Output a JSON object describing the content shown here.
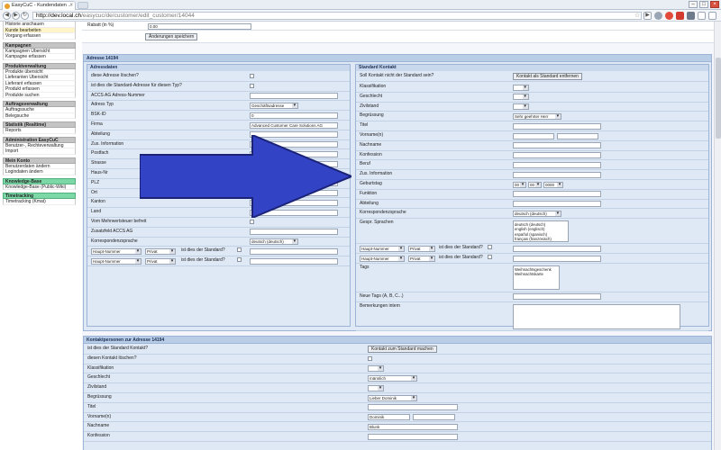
{
  "browser": {
    "tab_title": "EasyCuC - Kundendaten ...",
    "url_host": "http://dev.local.ch",
    "url_path": "/easycuc/de/customer/edit_customer/14044"
  },
  "sidebar": [
    {
      "items": [
        "Historie anschauen",
        "Kunde bearbeiten",
        "Vorgang erfassen"
      ],
      "active": 1
    },
    {
      "title": "Kampagnen",
      "items": [
        "Kampagnen Übersicht",
        "Kampagne erfassen"
      ]
    },
    {
      "title": "Produktverwaltung",
      "items": [
        "Produkte übersicht",
        "Lieferanten Übersicht",
        "Lieferant erfassen",
        "Produkt erfassen",
        "Produkte suchen"
      ]
    },
    {
      "title": "Auftragsverwaltung",
      "items": [
        "Auftragssuche",
        "Belegsuche"
      ]
    },
    {
      "title": "Statistik (Realtime)",
      "items": [
        "Reports"
      ]
    },
    {
      "title": "Administration EasyCuC",
      "items": [
        "Benutzer-, Rechteverwaltung",
        "Import"
      ]
    },
    {
      "title": "Mein Konto",
      "items": [
        "Benutzerdaten ändern",
        "Logindaten ändern"
      ]
    },
    {
      "title": "Knowledge-Base",
      "items": [
        "Knowledge-Base (Public-Wiki)"
      ],
      "green": true
    },
    {
      "title": "Timetracking",
      "items": [
        "Timetracking (Kmat)"
      ],
      "green": true
    }
  ],
  "top": {
    "rabatt_label": "Rabatt (in %)",
    "rabatt_value": "0.00",
    "save_button": "Änderungen speichern"
  },
  "address": {
    "section_title": "Adresse 14194",
    "left_title": "Adressdaten",
    "rows": [
      {
        "label": "diese Adresse löschen?",
        "type": "checkbox"
      },
      {
        "label": "ist dies die Standard-Adresse für diesen Typ?",
        "type": "checkbox"
      },
      {
        "label": "ACCS AG Adress-Nummer",
        "type": "input",
        "value": ""
      },
      {
        "label": "Adress Typ",
        "type": "select",
        "value": "Geschäftsadresse"
      },
      {
        "label": "BSK-ID",
        "type": "input",
        "value": "0"
      },
      {
        "label": "Firma",
        "type": "input",
        "value": "Advanced Customer Care Solutions AG"
      },
      {
        "label": "Abteilung",
        "type": "input",
        "value": ""
      },
      {
        "label": "Zus. Information",
        "type": "input",
        "value": ""
      },
      {
        "label": "Postfach",
        "type": "input",
        "value": ""
      },
      {
        "label": "Strasse",
        "type": "input",
        "value": ""
      },
      {
        "label": "Haus-Nr",
        "type": "input",
        "value": ""
      },
      {
        "label": "PLZ",
        "type": "input",
        "value": ""
      },
      {
        "label": "Ort",
        "type": "input",
        "value": ""
      },
      {
        "label": "Kanton",
        "type": "input",
        "value": ""
      },
      {
        "label": "Land",
        "type": "input",
        "value": ""
      },
      {
        "label": "Vom Mehrwertsteuer befreit",
        "type": "checkbox"
      },
      {
        "label": "Zusatzfeld ACCS AG",
        "type": "input",
        "value": ""
      },
      {
        "label": "Korrespondenzsprache",
        "type": "select",
        "value": "deutsch (deutsch)"
      }
    ],
    "phone_type": "Haupt-Nummer",
    "phone_kind": "Privat",
    "phone_question": "ist dies der Standard?",
    "right_title": "Standard Kontakt",
    "contact_rows": [
      {
        "label": "Soll Kontakt nicht der Standard sein?",
        "type": "button",
        "value": "Kontakt als Standard entfernen"
      },
      {
        "label": "Klassifikation",
        "type": "select",
        "value": ""
      },
      {
        "label": "Geschlecht",
        "type": "select",
        "value": ""
      },
      {
        "label": "Zivilstand",
        "type": "select",
        "value": ""
      },
      {
        "label": "Begrüssung",
        "type": "select",
        "value": "Sehr geehrter Herr"
      },
      {
        "label": "Titel",
        "type": "input",
        "value": ""
      },
      {
        "label": "Vorname(n)",
        "type": "input2",
        "value": ""
      },
      {
        "label": "Nachname",
        "type": "input",
        "value": ""
      },
      {
        "label": "Konfession",
        "type": "input",
        "value": ""
      },
      {
        "label": "Beruf",
        "type": "input",
        "value": ""
      },
      {
        "label": "Zus. Information",
        "type": "input",
        "value": ""
      },
      {
        "label": "Geburtstag",
        "type": "date",
        "value": "00",
        "value2": "00",
        "value3": "0000"
      },
      {
        "label": "Funktion",
        "type": "input",
        "value": ""
      },
      {
        "label": "Abteilung",
        "type": "input",
        "value": ""
      },
      {
        "label": "Korrespondenzsprache",
        "type": "select",
        "value": "deutsch (deutsch)"
      }
    ],
    "languages_label": "Gespr. Sprachen",
    "languages": [
      "deutsch (deutsch)",
      "english (englisch)",
      "español (spanisch)",
      "français (französisch)"
    ],
    "tags_label": "Tags",
    "tags": [
      "Weihnachtsgeschenk",
      "Weihnachtskarte"
    ],
    "new_tags_label": "Neue Tags (A, B, C...)",
    "remarks_label": "Bemerkungen intern"
  },
  "contacts": {
    "section_title": "Kontaktpersonen zur Adresse 14194",
    "rows": [
      {
        "label": "ist dies der Standard Kontakt?",
        "type": "button",
        "value": "Kontakt zum Standard machen"
      },
      {
        "label": "diesen Kontakt löschen?",
        "type": "checkbox"
      },
      {
        "label": "Klassifikation",
        "type": "select",
        "value": ""
      },
      {
        "label": "Geschlecht",
        "type": "select",
        "value": "männlich"
      },
      {
        "label": "Zivilstand",
        "type": "select",
        "value": ""
      },
      {
        "label": "Begrüssung",
        "type": "select",
        "value": "Lieber Dominik"
      },
      {
        "label": "Titel",
        "type": "input",
        "value": ""
      },
      {
        "label": "Vorname(n)",
        "type": "input2",
        "value": "Dominik"
      },
      {
        "label": "Nachname",
        "type": "input",
        "value": "Blunk"
      },
      {
        "label": "Konfession",
        "type": "input",
        "value": ""
      }
    ]
  },
  "colors": {
    "arrow": "#3343c6",
    "arrow_stroke": "#1b2378",
    "panel_head": "#b9cde6"
  }
}
